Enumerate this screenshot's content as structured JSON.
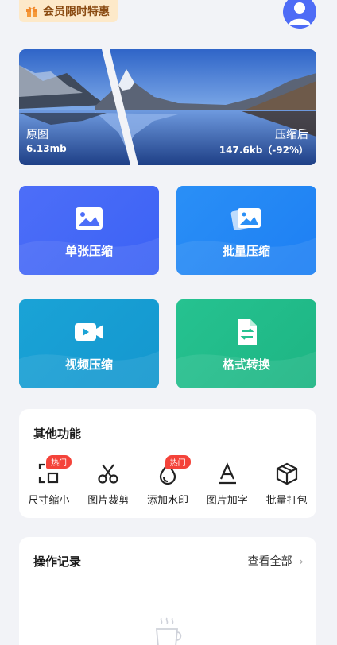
{
  "header": {
    "vip_label": "会员限时特惠",
    "gift_icon": "gift-icon",
    "avatar_icon": "user-avatar-icon",
    "accent": "#4e6cf6"
  },
  "banner": {
    "original_label": "原图",
    "original_size": "6.13mb",
    "compressed_label": "压缩后",
    "compressed_size": "147.6kb（-92%）"
  },
  "cards": [
    {
      "label": "单张压缩",
      "icon": "image-icon",
      "color": "#4d6ef8"
    },
    {
      "label": "批量压缩",
      "icon": "images-stack-icon",
      "color": "#2a8ff6"
    },
    {
      "label": "视频压缩",
      "icon": "video-camera-icon",
      "color": "#1aa3d6"
    },
    {
      "label": "格式转换",
      "icon": "file-convert-icon",
      "color": "#26c290"
    }
  ],
  "other": {
    "title": "其他功能",
    "hot_label": "热门",
    "tools": [
      {
        "label": "尺寸缩小",
        "icon": "resize-icon",
        "hot": true
      },
      {
        "label": "图片裁剪",
        "icon": "scissors-icon",
        "hot": false
      },
      {
        "label": "添加水印",
        "icon": "watermark-drop-icon",
        "hot": true
      },
      {
        "label": "图片加字",
        "icon": "text-icon",
        "hot": false
      },
      {
        "label": "批量打包",
        "icon": "package-box-icon",
        "hot": false
      }
    ]
  },
  "records": {
    "title": "操作记录",
    "view_all": "查看全部",
    "chevron": "›",
    "empty_icon": "coffee-cup-icon"
  }
}
